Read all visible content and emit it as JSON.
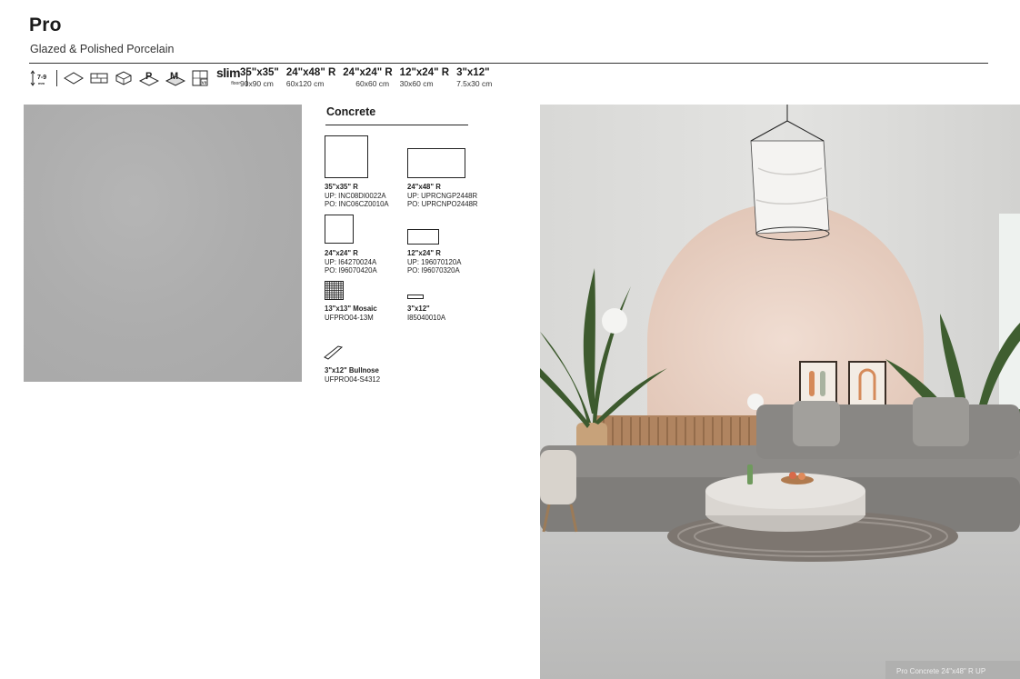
{
  "header": {
    "title": "Pro",
    "subtitle": "Glazed & Polished Porcelain"
  },
  "icons": [
    {
      "name": "thickness-icon",
      "text": "7-9",
      "unit": "mm"
    },
    {
      "name": "floor-tile-icon"
    },
    {
      "name": "wall-tile-icon"
    },
    {
      "name": "outdoor-tile-icon"
    },
    {
      "name": "polished-icon",
      "text": "P"
    },
    {
      "name": "matte-icon",
      "text": "M"
    },
    {
      "name": "shade-variation-icon",
      "text": "V3"
    },
    {
      "name": "slim-icon",
      "text": "slim",
      "subtext": "floor"
    }
  ],
  "sizes": [
    {
      "in": "35\"x35\"",
      "cm": "90x90 cm"
    },
    {
      "in": "24\"x48\" R",
      "cm": "60x120 cm"
    },
    {
      "in": "24\"x24\" R",
      "cm": "60x60 cm"
    },
    {
      "in": "12\"x24\" R",
      "cm": "30x60 cm"
    },
    {
      "in": "3\"x12\"",
      "cm": "7.5x30 cm"
    }
  ],
  "color_section": {
    "title": "Concrete",
    "swatch_color": "#adadad"
  },
  "products": [
    {
      "name": "35\"x35\" R",
      "code1": "UP: INC08DI0022A",
      "code2": "PO: INC06CZ0010A"
    },
    {
      "name": "24\"x48\" R",
      "code1": "UP: UPRCNGP2448R",
      "code2": "PO: UPRCNPO2448R"
    },
    {
      "name": "24\"x24\" R",
      "code1": "UP: I64270024A",
      "code2": "PO: I96070420A"
    },
    {
      "name": "12\"x24\" R",
      "code1": "UP: 196070120A",
      "code2": "PO: I96070320A"
    },
    {
      "name": "13\"x13\" Mosaic",
      "code1": "UFPRO04-13M"
    },
    {
      "name": "3\"x12\"",
      "code1": "I85040010A"
    },
    {
      "name": "3\"x12\" Bullnose",
      "code1": "UFPRO04-S4312"
    }
  ],
  "photo": {
    "caption": "Pro Concrete 24\"x48\" R UP"
  }
}
